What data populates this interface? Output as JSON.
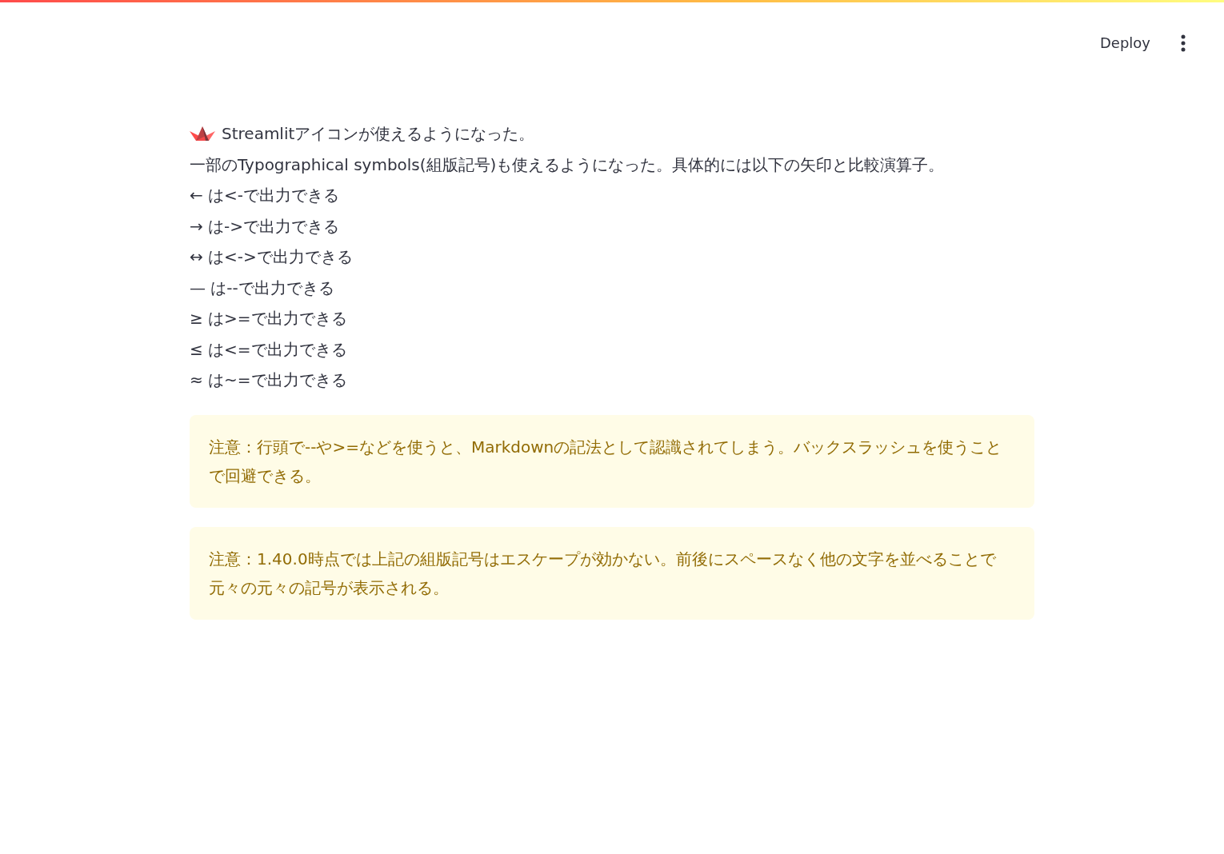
{
  "header": {
    "deploy": "Deploy"
  },
  "lines": [
    {
      "kind": "icon",
      "text": "Streamlitアイコンが使えるようになった。"
    },
    {
      "kind": "plain",
      "text": "一部のTypographical symbols(組版記号)も使えるようになった。具体的には以下の矢印と比較演算子。"
    },
    {
      "kind": "plain",
      "text": "← は<-で出力できる"
    },
    {
      "kind": "plain",
      "text": "→ は->で出力できる"
    },
    {
      "kind": "plain",
      "text": "↔ は<->で出力できる"
    },
    {
      "kind": "plain",
      "text": "— は--で出力できる"
    },
    {
      "kind": "plain",
      "text": "≥ は>=で出力できる"
    },
    {
      "kind": "plain",
      "text": "≤ は<=で出力できる"
    },
    {
      "kind": "plain",
      "text": "≈ は~=で出力できる"
    }
  ],
  "alerts": [
    {
      "kind": "warning",
      "text": "注意：行頭で--や>=などを使うと、Markdownの記法として認識されてしまう。バックスラッシュを使うことで回避できる。"
    },
    {
      "kind": "warning",
      "text": "注意：1.40.0時点では上記の組版記号はエスケープが効かない。前後にスペースなく他の文字を並べることで元々の元々の記号が表示される。"
    }
  ]
}
